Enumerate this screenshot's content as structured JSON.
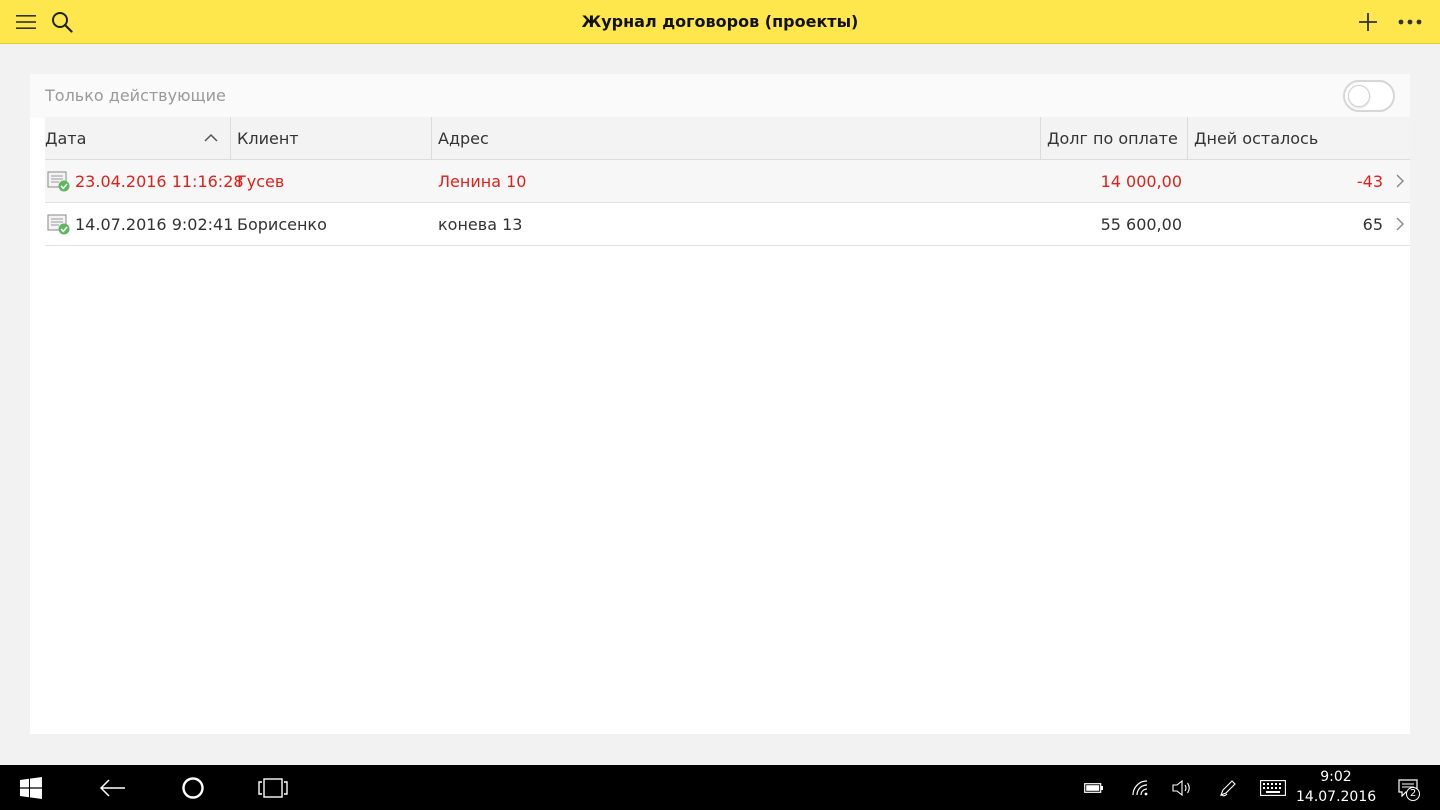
{
  "header": {
    "title": "Журнал договоров (проекты)",
    "color": "#fde74c",
    "icons": [
      "hamburger-icon",
      "search-icon",
      "plus-icon",
      "more-icon"
    ]
  },
  "filter": {
    "label": "Только действующие",
    "toggle_on": false
  },
  "table": {
    "columns": [
      "Дата",
      "Клиент",
      "Адрес",
      "Долг по оплате",
      "Дней осталось"
    ],
    "sort": {
      "column": "Дата",
      "direction": "asc"
    },
    "rows": [
      {
        "date": "23.04.2016 11:16:28",
        "client": "Гусев",
        "address": "Ленина 10",
        "debt": "14 000,00",
        "days_left": "-43",
        "highlight": "#e0201b"
      },
      {
        "date": "14.07.2016 9:02:41",
        "client": "Борисенко",
        "address": "конева 13",
        "debt": "55 600,00",
        "days_left": "65",
        "highlight": "#333333"
      }
    ]
  },
  "taskbar": {
    "time": "9:02",
    "date": "14.07.2016",
    "notification_count": "2",
    "icons": [
      "windows-icon",
      "back-arrow-icon",
      "cortana-circle-icon",
      "task-view-icon",
      "battery-icon",
      "wifi-icon",
      "volume-icon",
      "pen-icon",
      "keyboard-icon",
      "action-center-icon"
    ]
  }
}
